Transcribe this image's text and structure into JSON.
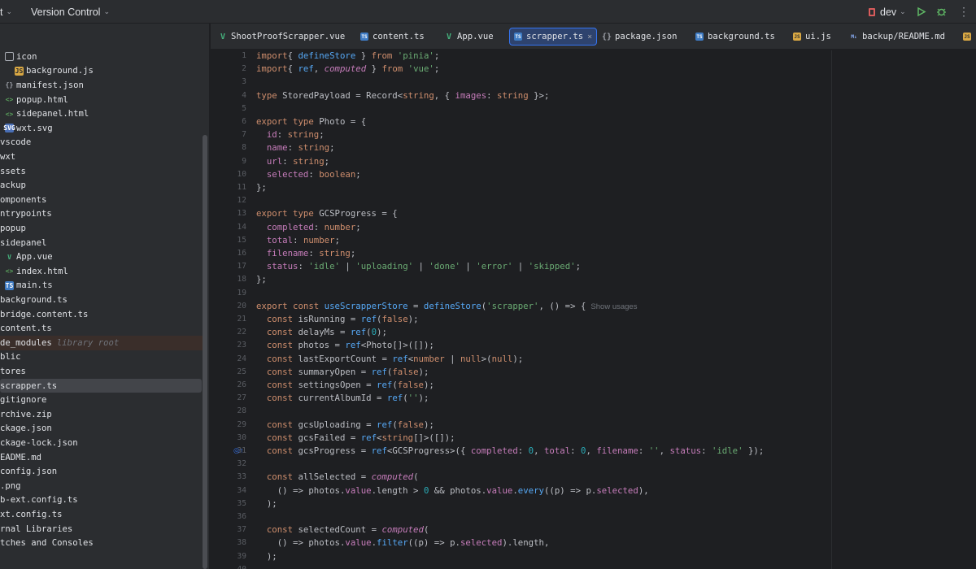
{
  "topbar": {
    "project_menu": "t",
    "vcs_menu": "Version Control",
    "branch": "dev"
  },
  "tree": [
    {
      "label": "icon",
      "icon": "folder"
    },
    {
      "label": "background.js",
      "icon": "js"
    },
    {
      "label": "manifest.json",
      "icon": "json"
    },
    {
      "label": "popup.html",
      "icon": "html"
    },
    {
      "label": "sidepanel.html",
      "icon": "html"
    },
    {
      "label": "wxt.svg",
      "icon": "svg"
    },
    {
      "label": "vscode",
      "icon": "none"
    },
    {
      "label": "wxt",
      "icon": "none"
    },
    {
      "label": "ssets",
      "icon": "none"
    },
    {
      "label": "ackup",
      "icon": "none"
    },
    {
      "label": "omponents",
      "icon": "none"
    },
    {
      "label": "ntrypoints",
      "icon": "none"
    },
    {
      "label": "popup",
      "icon": "none"
    },
    {
      "label": "sidepanel",
      "icon": "none"
    },
    {
      "label": "App.vue",
      "icon": "vue"
    },
    {
      "label": "index.html",
      "icon": "html"
    },
    {
      "label": "main.ts",
      "icon": "ts"
    },
    {
      "label": "background.ts",
      "icon": "none"
    },
    {
      "label": "bridge.content.ts",
      "icon": "none"
    },
    {
      "label": "content.ts",
      "icon": "none"
    },
    {
      "label": "de_modules",
      "icon": "none",
      "hint": "library root"
    },
    {
      "label": "blic",
      "icon": "none"
    },
    {
      "label": "tores",
      "icon": "none"
    },
    {
      "label": "scrapper.ts",
      "icon": "none",
      "selected": true
    },
    {
      "label": "gitignore",
      "icon": "none"
    },
    {
      "label": "rchive.zip",
      "icon": "none"
    },
    {
      "label": "ckage.json",
      "icon": "none"
    },
    {
      "label": "ckage-lock.json",
      "icon": "none"
    },
    {
      "label": "EADME.md",
      "icon": "none"
    },
    {
      "label": "config.json",
      "icon": "none"
    },
    {
      "label": ".png",
      "icon": "none"
    },
    {
      "label": "b-ext.config.ts",
      "icon": "none"
    },
    {
      "label": "xt.config.ts",
      "icon": "none"
    },
    {
      "label": "rnal Libraries",
      "icon": "none"
    },
    {
      "label": "tches and Consoles",
      "icon": "none"
    }
  ],
  "tabs": [
    {
      "label": "ShootProofScrapper.vue",
      "icon": "vue"
    },
    {
      "label": "content.ts",
      "icon": "ts"
    },
    {
      "label": "App.vue",
      "icon": "vue"
    },
    {
      "label": "scrapper.ts",
      "icon": "ts",
      "active": true
    },
    {
      "label": "package.json",
      "icon": "json"
    },
    {
      "label": "background.ts",
      "icon": "ts"
    },
    {
      "label": "ui.js",
      "icon": "js"
    },
    {
      "label": "backup/README.md",
      "icon": "md"
    },
    {
      "label": "",
      "icon": "js"
    }
  ],
  "code_lines": [
    [
      [
        "kw",
        "import"
      ],
      [
        "",
        "{ "
      ],
      [
        "fn",
        "defineStore"
      ],
      [
        "",
        " } "
      ],
      [
        "kw",
        "from"
      ],
      [
        "",
        " "
      ],
      [
        "str",
        "'pinia'"
      ],
      [
        "",
        ";"
      ]
    ],
    [
      [
        "kw",
        "import"
      ],
      [
        "",
        "{ "
      ],
      [
        "fn",
        "ref"
      ],
      [
        "",
        ", "
      ],
      [
        "it",
        "computed"
      ],
      [
        "",
        " } "
      ],
      [
        "kw",
        "from"
      ],
      [
        "",
        " "
      ],
      [
        "str",
        "'vue'"
      ],
      [
        "",
        ";"
      ]
    ],
    [],
    [
      [
        "kw",
        "type"
      ],
      [
        "",
        " StoredPayload = Record<"
      ],
      [
        "kw",
        "string"
      ],
      [
        "",
        ", { "
      ],
      [
        "prop",
        "images"
      ],
      [
        "",
        ": "
      ],
      [
        "kw",
        "string"
      ],
      [
        "",
        " }>;"
      ]
    ],
    [],
    [
      [
        "kw",
        "export type"
      ],
      [
        "",
        " Photo = {"
      ]
    ],
    [
      [
        "",
        "  "
      ],
      [
        "prop",
        "id"
      ],
      [
        "",
        ": "
      ],
      [
        "kw",
        "string"
      ],
      [
        "",
        ";"
      ]
    ],
    [
      [
        "",
        "  "
      ],
      [
        "prop",
        "name"
      ],
      [
        "",
        ": "
      ],
      [
        "kw",
        "string"
      ],
      [
        "",
        ";"
      ]
    ],
    [
      [
        "",
        "  "
      ],
      [
        "prop",
        "url"
      ],
      [
        "",
        ": "
      ],
      [
        "kw",
        "string"
      ],
      [
        "",
        ";"
      ]
    ],
    [
      [
        "",
        "  "
      ],
      [
        "prop",
        "selected"
      ],
      [
        "",
        ": "
      ],
      [
        "kw",
        "boolean"
      ],
      [
        "",
        ";"
      ]
    ],
    [
      [
        "",
        "};"
      ]
    ],
    [],
    [
      [
        "kw",
        "export type"
      ],
      [
        "",
        " GCSProgress = {"
      ]
    ],
    [
      [
        "",
        "  "
      ],
      [
        "prop",
        "completed"
      ],
      [
        "",
        ": "
      ],
      [
        "kw",
        "number"
      ],
      [
        "",
        ";"
      ]
    ],
    [
      [
        "",
        "  "
      ],
      [
        "prop",
        "total"
      ],
      [
        "",
        ": "
      ],
      [
        "kw",
        "number"
      ],
      [
        "",
        ";"
      ]
    ],
    [
      [
        "",
        "  "
      ],
      [
        "prop",
        "filename"
      ],
      [
        "",
        ": "
      ],
      [
        "kw",
        "string"
      ],
      [
        "",
        ";"
      ]
    ],
    [
      [
        "",
        "  "
      ],
      [
        "prop",
        "status"
      ],
      [
        "",
        ": "
      ],
      [
        "str",
        "'idle'"
      ],
      [
        "",
        " | "
      ],
      [
        "str",
        "'uploading'"
      ],
      [
        "",
        " | "
      ],
      [
        "str",
        "'done'"
      ],
      [
        "",
        " | "
      ],
      [
        "str",
        "'error'"
      ],
      [
        "",
        " | "
      ],
      [
        "str",
        "'skipped'"
      ],
      [
        "",
        ";"
      ]
    ],
    [
      [
        "",
        "};"
      ]
    ],
    [],
    [
      [
        "kw",
        "export const"
      ],
      [
        "",
        " "
      ],
      [
        "fn",
        "useScrapperStore"
      ],
      [
        "",
        " = "
      ],
      [
        "fn",
        "defineStore"
      ],
      [
        "",
        "("
      ],
      [
        "str",
        "'scrapper'"
      ],
      [
        "",
        ", () => {"
      ],
      [
        "hint",
        "Show usages"
      ]
    ],
    [
      [
        "",
        "  "
      ],
      [
        "kw",
        "const"
      ],
      [
        "",
        " isRunning = "
      ],
      [
        "fn",
        "ref"
      ],
      [
        "",
        "("
      ],
      [
        "kw",
        "false"
      ],
      [
        "",
        ");"
      ]
    ],
    [
      [
        "",
        "  "
      ],
      [
        "kw",
        "const"
      ],
      [
        "",
        " delayMs = "
      ],
      [
        "fn",
        "ref"
      ],
      [
        "",
        "("
      ],
      [
        "num",
        "0"
      ],
      [
        "",
        ");"
      ]
    ],
    [
      [
        "",
        "  "
      ],
      [
        "kw",
        "const"
      ],
      [
        "",
        " photos = "
      ],
      [
        "fn",
        "ref"
      ],
      [
        "",
        "<Photo[]>([]);"
      ]
    ],
    [
      [
        "",
        "  "
      ],
      [
        "kw",
        "const"
      ],
      [
        "",
        " lastExportCount = "
      ],
      [
        "fn",
        "ref"
      ],
      [
        "",
        "<"
      ],
      [
        "kw",
        "number"
      ],
      [
        "",
        " | "
      ],
      [
        "kw",
        "null"
      ],
      [
        "",
        ">("
      ],
      [
        "kw",
        "null"
      ],
      [
        "",
        ");"
      ]
    ],
    [
      [
        "",
        "  "
      ],
      [
        "kw",
        "const"
      ],
      [
        "",
        " summaryOpen = "
      ],
      [
        "fn",
        "ref"
      ],
      [
        "",
        "("
      ],
      [
        "kw",
        "false"
      ],
      [
        "",
        ");"
      ]
    ],
    [
      [
        "",
        "  "
      ],
      [
        "kw",
        "const"
      ],
      [
        "",
        " settingsOpen = "
      ],
      [
        "fn",
        "ref"
      ],
      [
        "",
        "("
      ],
      [
        "kw",
        "false"
      ],
      [
        "",
        ");"
      ]
    ],
    [
      [
        "",
        "  "
      ],
      [
        "kw",
        "const"
      ],
      [
        "",
        " currentAlbumId = "
      ],
      [
        "fn",
        "ref"
      ],
      [
        "",
        "("
      ],
      [
        "str",
        "''"
      ],
      [
        "",
        ");"
      ]
    ],
    [],
    [
      [
        "",
        "  "
      ],
      [
        "kw",
        "const"
      ],
      [
        "",
        " gcsUploading = "
      ],
      [
        "fn",
        "ref"
      ],
      [
        "",
        "("
      ],
      [
        "kw",
        "false"
      ],
      [
        "",
        ");"
      ]
    ],
    [
      [
        "",
        "  "
      ],
      [
        "kw",
        "const"
      ],
      [
        "",
        " gcsFailed = "
      ],
      [
        "fn",
        "ref"
      ],
      [
        "",
        "<"
      ],
      [
        "kw",
        "string"
      ],
      [
        "",
        "[]>([]);"
      ]
    ],
    [
      [
        "",
        "  "
      ],
      [
        "kw",
        "const"
      ],
      [
        "",
        " gcsProgress = "
      ],
      [
        "fn",
        "ref"
      ],
      [
        "",
        "<GCSProgress>({ "
      ],
      [
        "prop",
        "completed"
      ],
      [
        "",
        ": "
      ],
      [
        "num",
        "0"
      ],
      [
        "",
        ", "
      ],
      [
        "prop",
        "total"
      ],
      [
        "",
        ": "
      ],
      [
        "num",
        "0"
      ],
      [
        "",
        ", "
      ],
      [
        "prop",
        "filename"
      ],
      [
        "",
        ": "
      ],
      [
        "str",
        "''"
      ],
      [
        "",
        ", "
      ],
      [
        "prop",
        "status"
      ],
      [
        "",
        ": "
      ],
      [
        "str",
        "'idle'"
      ],
      [
        "",
        " });"
      ]
    ],
    [],
    [
      [
        "",
        "  "
      ],
      [
        "kw",
        "const"
      ],
      [
        "",
        " allSelected = "
      ],
      [
        "it",
        "computed"
      ],
      [
        "",
        "("
      ]
    ],
    [
      [
        "",
        "    () => photos."
      ],
      [
        "prop",
        "value"
      ],
      [
        "",
        ".length > "
      ],
      [
        "num",
        "0"
      ],
      [
        "",
        " && photos."
      ],
      [
        "prop",
        "value"
      ],
      [
        "",
        "."
      ],
      [
        "fn",
        "every"
      ],
      [
        "",
        "((p) => p."
      ],
      [
        "prop",
        "selected"
      ],
      [
        "",
        "),"
      ]
    ],
    [
      [
        "",
        "  );"
      ]
    ],
    [],
    [
      [
        "",
        "  "
      ],
      [
        "kw",
        "const"
      ],
      [
        "",
        " selectedCount = "
      ],
      [
        "it",
        "computed"
      ],
      [
        "",
        "("
      ]
    ],
    [
      [
        "",
        "    () => photos."
      ],
      [
        "prop",
        "value"
      ],
      [
        "",
        "."
      ],
      [
        "fn",
        "filter"
      ],
      [
        "",
        "((p) => p."
      ],
      [
        "prop",
        "selected"
      ],
      [
        "",
        ").length,"
      ]
    ],
    [
      [
        "",
        "  );"
      ]
    ],
    []
  ]
}
